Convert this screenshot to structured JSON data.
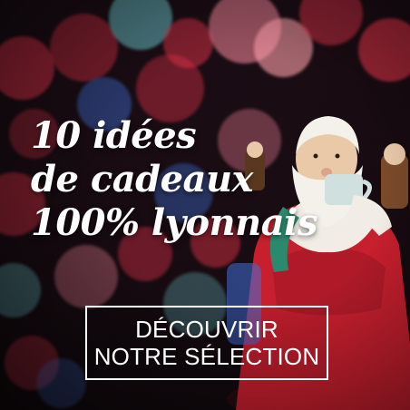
{
  "banner": {
    "headline_lines": [
      "10 idées",
      "de cadeaux",
      "100% lyonnais"
    ],
    "cta_lines": [
      "DÉCOUVRIR",
      "NOTRE SÉLECTION"
    ]
  },
  "colors": {
    "text": "#ffffff",
    "bokeh_red": "#e8334a",
    "bokeh_pink": "#ff8aa0",
    "bokeh_teal": "#6fd0d6",
    "bokeh_blue": "#3f6fd8",
    "background": "#1c0d14"
  },
  "icons": {
    "figurine": "santa-claus-figurine"
  }
}
